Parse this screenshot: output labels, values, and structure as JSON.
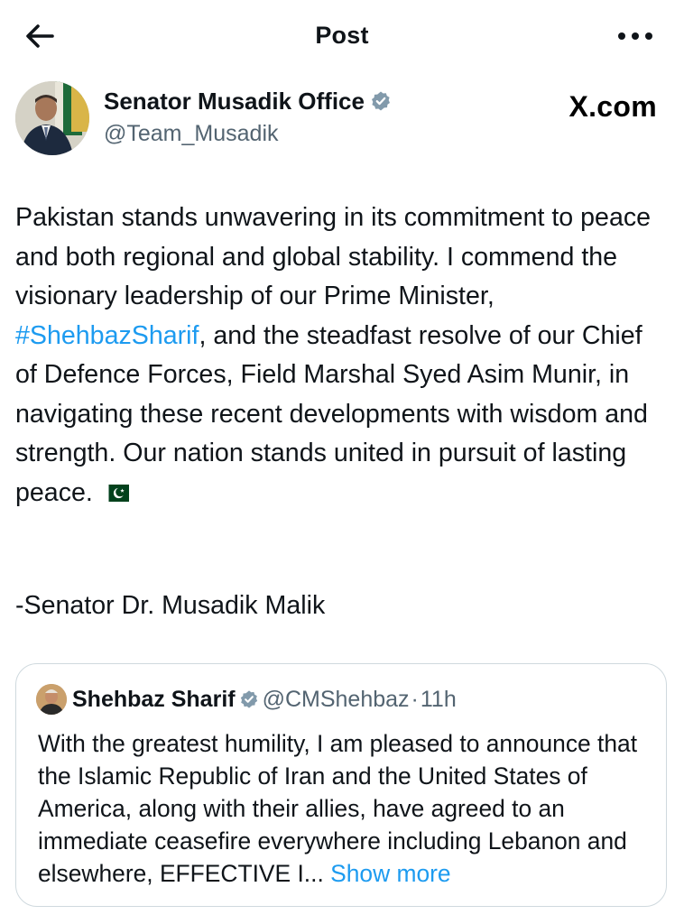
{
  "header": {
    "title": "Post",
    "back_icon": "back-arrow-icon",
    "more_icon": "more-horizontal-icon"
  },
  "author": {
    "name": "Senator Musadik Office",
    "handle": "@Team_Musadik",
    "verified": true,
    "verified_color": "#829aab"
  },
  "watermark": "X.com",
  "post": {
    "text_before_hashtag": "Pakistan stands unwavering in its commitment to peace and both regional and global stability. I commend the visionary leadership of our Prime Minister, ",
    "hashtag": "#ShehbazSharif",
    "text_after_hashtag": ", and the steadfast resolve of our Chief of Defence Forces, Field Marshal Syed Asim Munir, in navigating these recent developments with wisdom and strength. Our nation stands united in pursuit of lasting peace. ",
    "flag_emoji": "pakistan-flag",
    "signature": "-Senator Dr. Musadik Malik"
  },
  "quoted_post": {
    "author_name": "Shehbaz Sharif",
    "verified_color": "#829aab",
    "handle": "@CMShehbaz",
    "separator": "·",
    "time": "11h",
    "text": "With the greatest humility, I am pleased to announce that the Islamic Republic of Iran and the United States of America, along with their allies, have agreed to an immediate ceasefire everywhere including Lebanon and elsewhere, EFFECTIVE I...",
    "show_more": "Show more"
  },
  "colors": {
    "link": "#1d9bf0",
    "secondary_text": "#536471",
    "primary_text": "#0f1419",
    "border": "#cfd9de"
  }
}
